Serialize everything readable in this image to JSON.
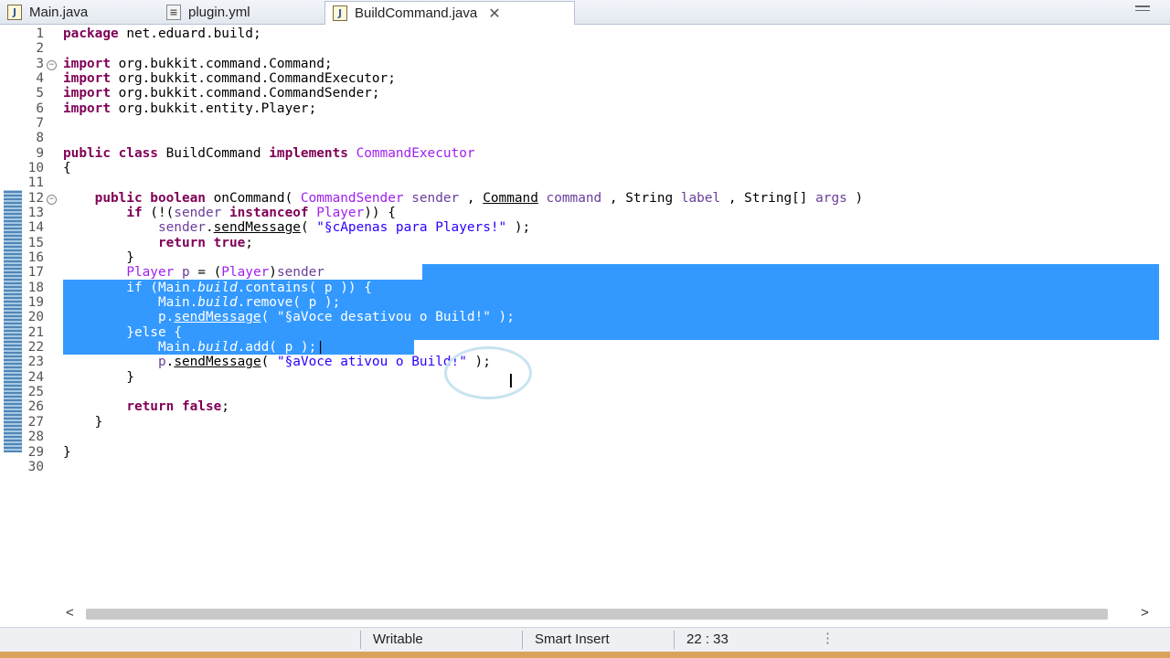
{
  "tabs": [
    {
      "label": "Main.java"
    },
    {
      "label": "plugin.yml"
    },
    {
      "label": "BuildCommand.java",
      "active": true
    }
  ],
  "editor": {
    "line_numbers": [
      "1",
      "2",
      "3",
      "4",
      "5",
      "6",
      "7",
      "8",
      "9",
      "10",
      "11",
      "12",
      "13",
      "14",
      "15",
      "16",
      "17",
      "18",
      "19",
      "20",
      "21",
      "22",
      "23",
      "24",
      "25",
      "26",
      "27",
      "28",
      "29",
      "30"
    ],
    "lines": [
      "package net.eduard.build;",
      "",
      "import org.bukkit.command.Command;",
      "import org.bukkit.command.CommandExecutor;",
      "import org.bukkit.command.CommandSender;",
      "import org.bukkit.entity.Player;",
      "",
      "",
      "public class BuildCommand implements CommandExecutor",
      "{",
      "",
      "    public boolean onCommand( CommandSender sender , Command command , String label , String[] args )",
      "        if (!(sender instanceof Player)) {",
      "            sender.sendMessage( \"§cApenas para Players!\" );",
      "            return true;",
      "        }",
      "        Player p = (Player)sender;",
      "        if (Main.build.contains( p )) {",
      "            Main.build.remove( p );",
      "            p.sendMessage( \"§aVoce desativou o Build!\" );",
      "        }else {",
      "            Main.build.add( p );",
      "            p.sendMessage( \"§aVoce ativou o Build!\" );",
      "        }",
      "",
      "        return false;",
      "    }",
      "",
      "}",
      ""
    ]
  },
  "status": {
    "writable": "Writable",
    "insert_mode": "Smart Insert",
    "cursor_position": "22 : 33"
  },
  "icons": {
    "tab_file": "java-file-icon",
    "close": "close-icon",
    "minimize": "minimize-icon"
  },
  "colors": {
    "selection": "#3399ff",
    "keyword": "#7f0055",
    "string": "#2a00ff"
  }
}
